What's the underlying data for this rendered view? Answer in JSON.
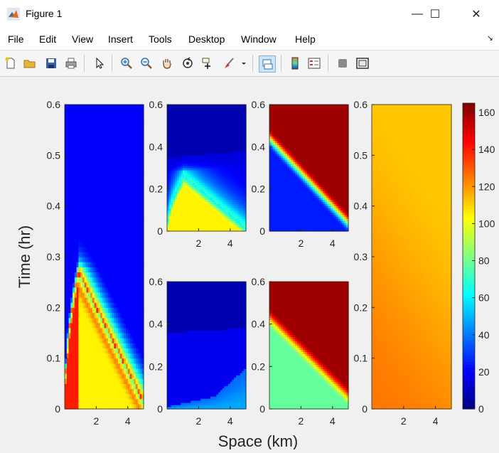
{
  "window": {
    "title": "Figure 1",
    "minimize_glyph": "—",
    "maximize_glyph": "☐",
    "close_glyph": "✕"
  },
  "menu": [
    "File",
    "Edit",
    "View",
    "Insert",
    "Tools",
    "Desktop",
    "Window",
    "Help"
  ],
  "toolbar": {
    "icons": [
      "new-figure-icon",
      "open-file-icon",
      "save-icon",
      "print-icon",
      "pointer-icon",
      "zoom-in-icon",
      "zoom-out-icon",
      "pan-hand-icon",
      "rotate-3d-icon",
      "data-cursor-icon",
      "brush-icon",
      "brush-dropdown-icon",
      "link-plot-icon",
      "insert-colorbar-icon",
      "insert-legend-icon",
      "hide-plot-tools-icon",
      "show-plot-tools-icon"
    ]
  },
  "colors": {
    "figure_bg": "#f0f0f0",
    "axes_bg": "#ffffff",
    "colormap": "jet"
  },
  "chart_data": [
    {
      "type": "heatmap",
      "position": "left, full height",
      "ylabel": "Time (hr)",
      "xlabel": "Space (km)",
      "xlim": [
        0,
        5
      ],
      "ylim": [
        0,
        0.6
      ],
      "xticks": [
        "2",
        "4"
      ],
      "yticks": [
        "0",
        "0.1",
        "0.2",
        "0.3",
        "0.4",
        "0.5",
        "0.6"
      ],
      "description_values": {
        "initial_condition_value": 140,
        "background_value": 20,
        "front_peak_time_hr": 0.27
      }
    },
    {
      "type": "heatmap",
      "position": "middle top",
      "xlim": [
        0,
        5
      ],
      "ylim": [
        0,
        0.6
      ],
      "xticks": [
        "2",
        "4"
      ],
      "yticks": [
        "0",
        "0.2",
        "0.4",
        "0.6"
      ],
      "description_values": {
        "initial_condition_value": 105,
        "background_value": 15,
        "front_peak_time_hr": 0.27
      }
    },
    {
      "type": "heatmap",
      "position": "middle bottom",
      "xlim": [
        0,
        5
      ],
      "ylim": [
        0,
        0.6
      ],
      "xticks": [
        "2",
        "4"
      ],
      "yticks": [
        "0",
        "0.2",
        "0.4",
        "0.6"
      ],
      "description_values": {
        "initial_condition_value": 48,
        "background_value": 18
      }
    },
    {
      "type": "heatmap",
      "position": "right top",
      "xlim": [
        0,
        5
      ],
      "ylim": [
        0,
        0.6
      ],
      "xticks": [
        "2",
        "4"
      ],
      "yticks": [
        "0",
        "0.2",
        "0.4",
        "0.6"
      ],
      "description_values": {
        "initial_condition_value": 25,
        "saturated_value": 160
      }
    },
    {
      "type": "heatmap",
      "position": "right bottom",
      "xlim": [
        0,
        5
      ],
      "ylim": [
        0,
        0.6
      ],
      "xticks": [
        "2",
        "4"
      ],
      "yticks": [
        "0",
        "0.2",
        "0.4",
        "0.6"
      ],
      "description_values": {
        "initial_condition_value": 78,
        "saturated_value": 160
      }
    },
    {
      "type": "heatmap",
      "position": "far right",
      "xlim": [
        0,
        5
      ],
      "ylim": [
        0,
        0.6
      ],
      "xticks": [
        "2",
        "4"
      ],
      "yticks": [
        "0",
        "0.1",
        "0.2",
        "0.3",
        "0.4",
        "0.5",
        "0.6"
      ],
      "description_values": {
        "low_value": 125,
        "high_value": 112
      }
    },
    {
      "type": "colorbar",
      "range": [
        0,
        165
      ],
      "ticks": [
        "0",
        "20",
        "40",
        "60",
        "80",
        "100",
        "120",
        "140",
        "160"
      ]
    }
  ]
}
